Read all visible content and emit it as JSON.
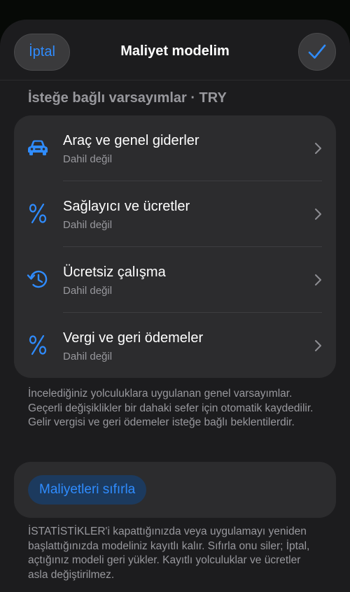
{
  "header": {
    "cancel_label": "İptal",
    "title": "Maliyet modelim",
    "confirm_icon": "checkmark-icon"
  },
  "section": {
    "title": "İsteğe bağlı varsayımlar · TRY"
  },
  "items": [
    {
      "label": "Araç ve genel giderler",
      "status": "Dahil değil",
      "icon": "car-icon"
    },
    {
      "label": "Sağlayıcı ve ücretler",
      "status": "Dahil değil",
      "icon": "percent-icon"
    },
    {
      "label": "Ücretsiz çalışma",
      "status": "Dahil değil",
      "icon": "history-clock-icon"
    },
    {
      "label": "Vergi ve geri ödemeler",
      "status": "Dahil değil",
      "icon": "percent-icon"
    }
  ],
  "notes": {
    "assumptions": "İncelediğiniz yolculuklara uygulanan genel varsayımlar. Geçerli değişiklikler bir dahaki sefer için otomatik kaydedilir. Gelir vergisi ve geri ödemeler isteğe bağlı beklentilerdir.",
    "reset_info": "İSTATİSTİKLER'i kapattığınızda veya uygulamayı yeniden başlattığınızda modeliniz kayıtlı kalır. Sıfırla onu siler; İptal, açtığınız modeli geri yükler. Kayıtlı yolculuklar ve ücretler asla değiştirilmez."
  },
  "reset": {
    "label": "Maliyetleri sıfırla"
  },
  "colors": {
    "accent": "#2f8cff",
    "background": "#1c1c1e",
    "card": "#2c2c2e",
    "secondary_text": "#98989d"
  }
}
